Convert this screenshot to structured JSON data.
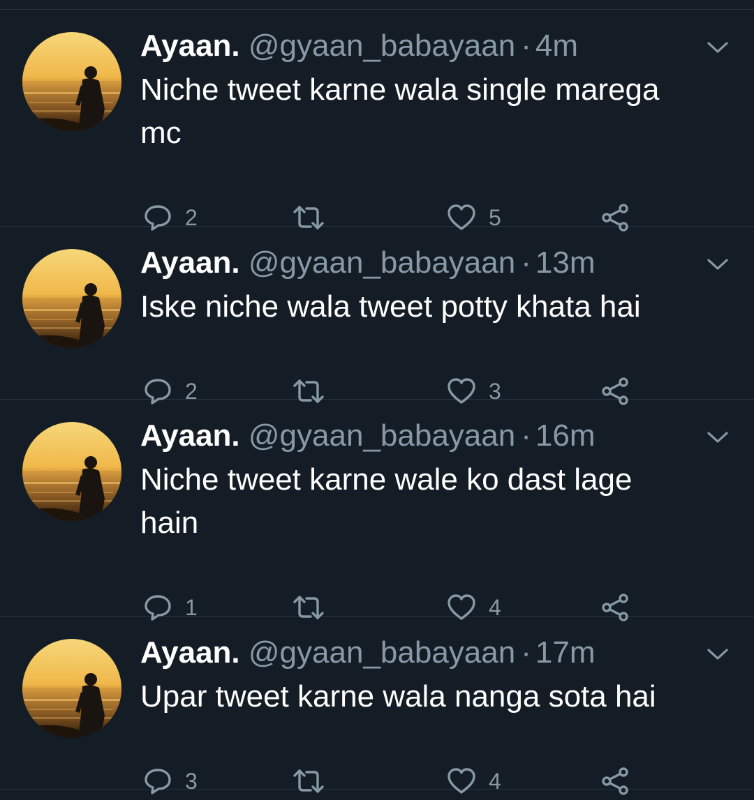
{
  "colors": {
    "background": "#141d26",
    "text_primary": "#ffffff",
    "text_secondary": "#8899a6",
    "divider": "#26333f"
  },
  "icons": {
    "reply": "reply-icon",
    "retweet": "retweet-icon",
    "like": "heart-icon",
    "share": "share-icon",
    "menu": "chevron-down-icon"
  },
  "tweets": [
    {
      "name": "Ayaan.",
      "handle": "@gyaan_babayaan",
      "separator": "·",
      "time": "4m",
      "text_lines": [
        "Niche tweet karne wala single marega",
        "mc"
      ],
      "replies": "2",
      "retweets": "",
      "likes": "5"
    },
    {
      "name": "Ayaan.",
      "handle": "@gyaan_babayaan",
      "separator": "·",
      "time": "13m",
      "text_lines": [
        "Iske niche wala tweet potty khata hai"
      ],
      "replies": "2",
      "retweets": "",
      "likes": "3"
    },
    {
      "name": "Ayaan.",
      "handle": "@gyaan_babayaan",
      "separator": "·",
      "time": "16m",
      "text_lines": [
        "Niche tweet karne wale ko dast lage",
        "hain"
      ],
      "replies": "1",
      "retweets": "",
      "likes": "4"
    },
    {
      "name": "Ayaan.",
      "handle": "@gyaan_babayaan",
      "separator": "·",
      "time": "17m",
      "text_lines": [
        "Upar tweet karne wala nanga sota hai"
      ],
      "replies": "3",
      "retweets": "",
      "likes": "4"
    }
  ]
}
